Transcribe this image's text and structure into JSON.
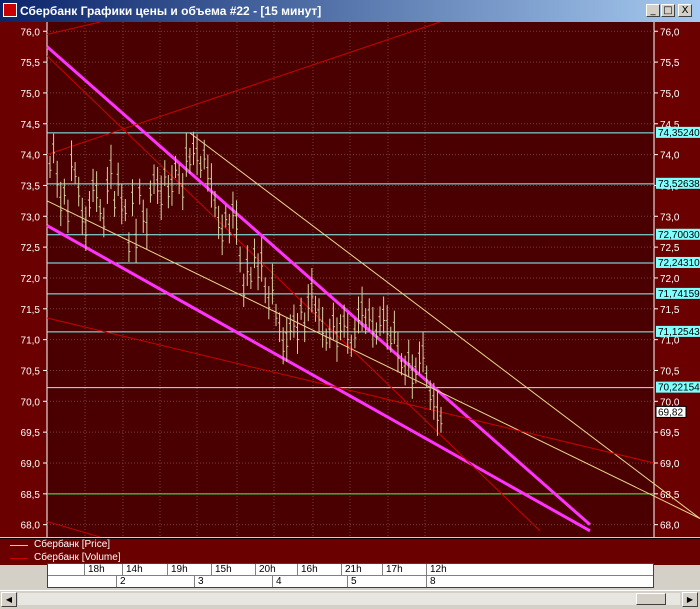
{
  "window": {
    "title": "Сбербанк Графики цены и объема #22 - [15 минут]",
    "buttons": {
      "minimize": "_",
      "restore": "□",
      "close": "X"
    }
  },
  "chart_data": {
    "type": "line",
    "title": "",
    "y_axis": {
      "range": [
        67.8,
        76.15
      ],
      "ticks": [
        "76,0",
        "75,5",
        "75,0",
        "74,5",
        "74,0",
        "73,5",
        "73,0",
        "72,5",
        "72,0",
        "71,5",
        "71,0",
        "70,5",
        "70,0",
        "69,5",
        "69,0",
        "68,5",
        "68,0"
      ]
    },
    "level_tags": [
      "74,35240",
      "73,52638",
      "72,70030",
      "72,24310",
      "71,74159",
      "71,12543",
      "70,22154"
    ],
    "last_price_tag": "69,82",
    "series": [
      {
        "name": "Сбербанк [Price]",
        "values": [
          73.8,
          74.1,
          73.6,
          73.2,
          73.4,
          73.0,
          73.9,
          73.7,
          73.4,
          73.0,
          72.8,
          73.2,
          73.5,
          73.4,
          73.1,
          72.9,
          73.5,
          73.8,
          73.2,
          73.6,
          73.2,
          73.1,
          72.5,
          73.3,
          72.6,
          73.4,
          73.0,
          72.8,
          73.4,
          73.6,
          73.5,
          73.3,
          73.7,
          73.4,
          73.5,
          73.8,
          73.6,
          73.4,
          74.0,
          73.9,
          74.1,
          74.0,
          73.8,
          74.0,
          73.7,
          73.5,
          73.2,
          72.9,
          72.7,
          73.0,
          72.8,
          73.1,
          72.9,
          72.3,
          71.8,
          72.2,
          72.0,
          72.4,
          72.1,
          72.3,
          71.8,
          71.6,
          71.9,
          71.4,
          71.2,
          70.9,
          71.0,
          71.2,
          71.3,
          71.1,
          71.5,
          71.2,
          71.6,
          71.8,
          71.5,
          71.4,
          71.2,
          71.0,
          71.1,
          71.3,
          71.0,
          71.2,
          71.3,
          71.1,
          70.9,
          71.1,
          71.4,
          71.5,
          71.3,
          71.4,
          71.2,
          71.1,
          71.3,
          71.4,
          71.2,
          71.0,
          71.2,
          70.8,
          70.6,
          70.5,
          70.7,
          70.4,
          70.5,
          70.7,
          70.8,
          70.4,
          70.1,
          70.0,
          69.8,
          69.7
        ]
      },
      {
        "name": "Сбербанк [Volume]"
      }
    ],
    "x_axis": {
      "hours": [
        "18h",
        "14h",
        "19h",
        "15h",
        "20h",
        "16h",
        "21h",
        "17h",
        "12h"
      ],
      "days": [
        "2",
        "3",
        "4",
        "5",
        "8"
      ]
    }
  },
  "colors": {
    "background": "#4a0000",
    "grid": "#7a3c3c",
    "price": "#d8cfa0",
    "volume": "#cc0000",
    "level": "#80ffff",
    "channel": "#ff33ff",
    "trend_light": "#e8d890",
    "green_level": "#40ff40"
  }
}
